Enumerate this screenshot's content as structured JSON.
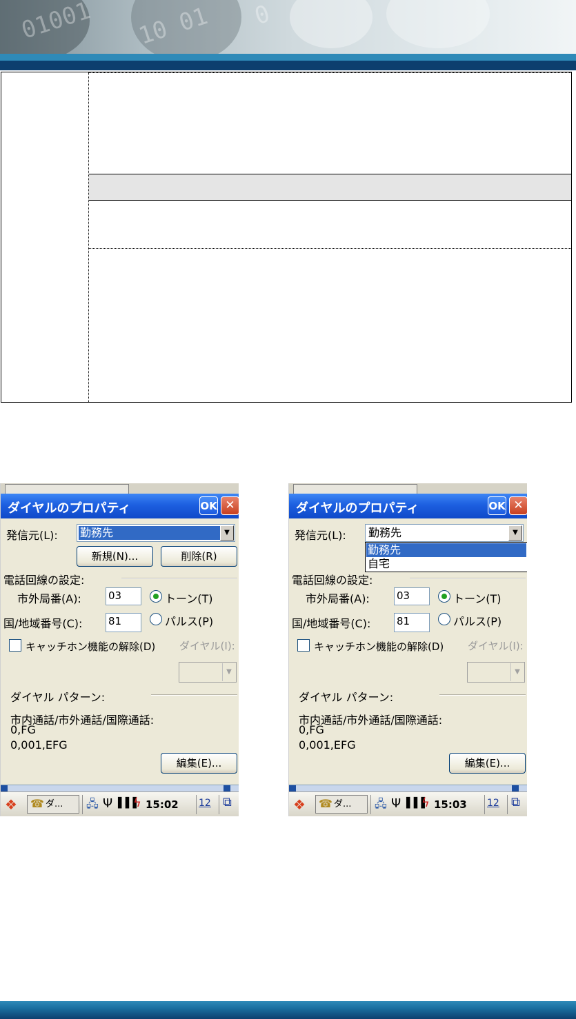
{
  "screens": [
    {
      "title": "ダイヤルのプロパティ",
      "ok": "OK",
      "close": "✕",
      "from_label": "発信元(L):",
      "from_value": "勤務先",
      "new_btn": "新規(N)...",
      "delete_btn": "削除(R)",
      "line_settings": "電話回線の設定:",
      "area_code_label": "市外局番(A):",
      "area_code": "03",
      "tone_label": "トーン(T)",
      "country_label": "国/地域番号(C):",
      "country_code": "81",
      "pulse_label": "パルス(P)",
      "call_waiting": "キャッチホン機能の解除(D)",
      "dial_label": "ダイヤル(I):",
      "dial_pattern": "ダイヤル パターン:",
      "pattern_header": "市内通話/市外通話/国際通話:",
      "pattern_local": "0,FG",
      "pattern_intl": "0,001,EFG",
      "edit_btn": "編集(E)...",
      "task_label": "ダ...",
      "time": "15:02",
      "calendar": "12",
      "dropdown_open": false,
      "options": []
    },
    {
      "title": "ダイヤルのプロパティ",
      "ok": "OK",
      "close": "✕",
      "from_label": "発信元(L):",
      "from_value": "勤務先",
      "new_btn": "新規(N)...",
      "delete_btn": "削除(R)",
      "line_settings": "電話回線の設定:",
      "area_code_label": "市外局番(A):",
      "area_code": "03",
      "tone_label": "トーン(T)",
      "country_label": "国/地域番号(C):",
      "country_code": "81",
      "pulse_label": "パルス(P)",
      "call_waiting": "キャッチホン機能の解除(D)",
      "dial_label": "ダイヤル(I):",
      "dial_pattern": "ダイヤル パターン:",
      "pattern_header": "市内通話/市外通話/国際通話:",
      "pattern_local": "0,FG",
      "pattern_intl": "0,001,EFG",
      "edit_btn": "編集(E)...",
      "task_label": "ダ...",
      "time": "15:03",
      "calendar": "12",
      "dropdown_open": true,
      "options": [
        "勤務先",
        "自宅"
      ]
    }
  ],
  "colors": {
    "title_bar": "#1d5fe0",
    "dialog_bg": "#ece9d8",
    "selection": "#316ac5",
    "header_bar": "#0d3f6e"
  }
}
